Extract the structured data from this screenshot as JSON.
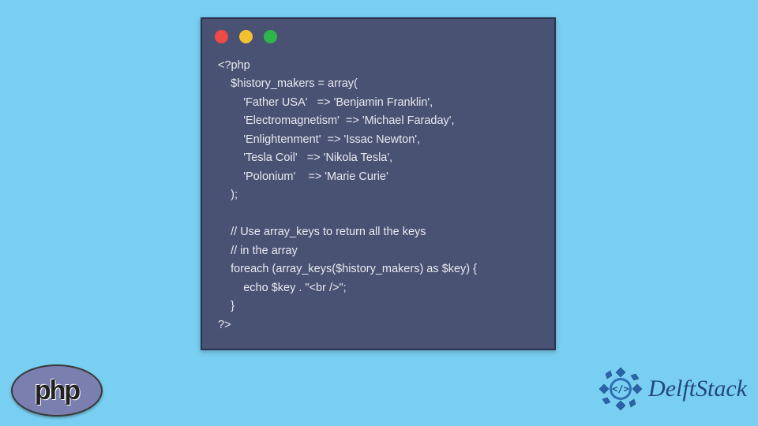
{
  "code": {
    "lines": [
      "<?php",
      "    $history_makers = array(",
      "        'Father USA'   => 'Benjamin Franklin',",
      "        'Electromagnetism'  => 'Michael Faraday',",
      "        'Enlightenment'  => 'Issac Newton',",
      "        'Tesla Coil'   => 'Nikola Tesla',",
      "        'Polonium'    => 'Marie Curie'",
      "    );",
      "",
      "    // Use array_keys to return all the keys",
      "    // in the array",
      "    foreach (array_keys($history_makers) as $key) {",
      "        echo $key . \"<br />\";",
      "    }",
      "?>"
    ]
  },
  "window": {
    "dot_red": "#ed4b45",
    "dot_yellow": "#f1c131",
    "dot_green": "#2fb44b",
    "bg": "#4a5274"
  },
  "php_logo_text": "php",
  "delft_text": "DelftStack"
}
